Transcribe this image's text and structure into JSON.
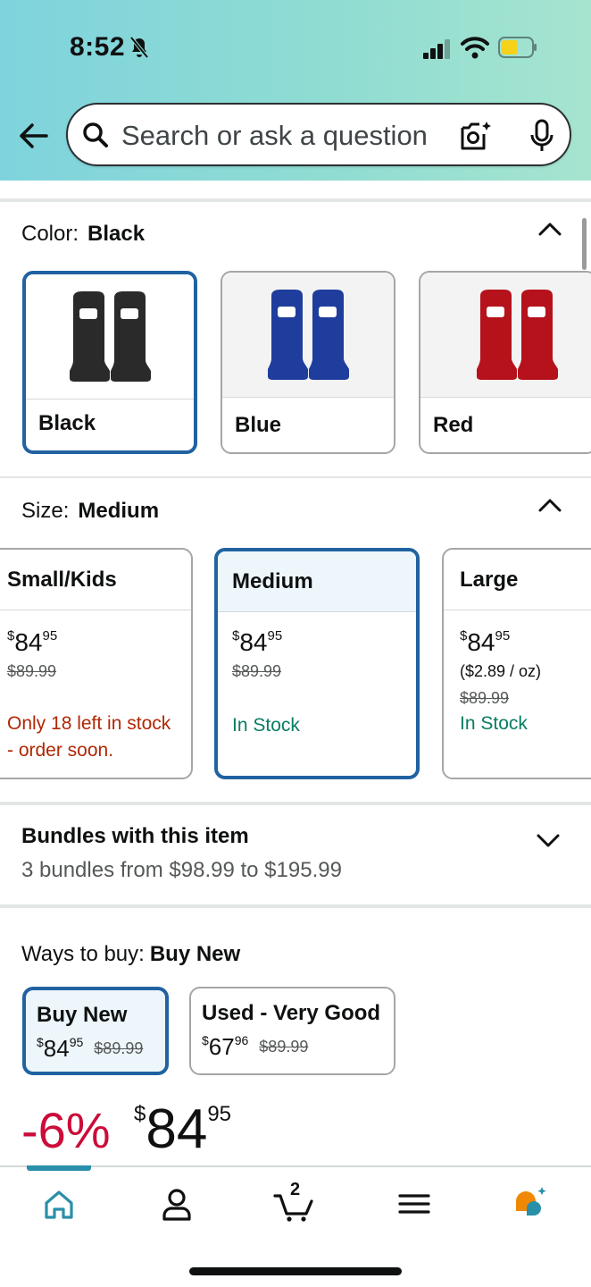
{
  "status_bar": {
    "time": "8:52"
  },
  "search": {
    "placeholder": "Search or ask a question"
  },
  "color_section": {
    "label": "Color:",
    "selected": "Black",
    "options": [
      {
        "label": "Black",
        "tint": "#2a2a2a"
      },
      {
        "label": "Blue",
        "tint": "#1f3d9c"
      },
      {
        "label": "Red",
        "tint": "#b5121b"
      }
    ]
  },
  "size_section": {
    "label": "Size:",
    "selected": "Medium",
    "options": [
      {
        "label": "Small/Kids",
        "price_whole": "84",
        "price_cents": "95",
        "currency": "$",
        "list_price": "$89.99",
        "unit_price": "",
        "stock": "Only 18 left in stock - order soon."
      },
      {
        "label": "Medium",
        "price_whole": "84",
        "price_cents": "95",
        "currency": "$",
        "list_price": "$89.99",
        "unit_price": "",
        "stock": "In Stock"
      },
      {
        "label": "Large",
        "price_whole": "84",
        "price_cents": "95",
        "currency": "$",
        "list_price": "$89.99",
        "unit_price": "($2.89 / oz)",
        "stock": "In Stock"
      }
    ]
  },
  "bundles": {
    "title": "Bundles with this item",
    "subtitle": "3 bundles from $98.99 to $195.99"
  },
  "ways_to_buy": {
    "label": "Ways to buy:",
    "selected": "Buy New",
    "options": [
      {
        "title": "Buy New",
        "currency": "$",
        "price_whole": "84",
        "price_cents": "95",
        "list_price": "$89.99"
      },
      {
        "title": "Used - Very Good",
        "currency": "$",
        "price_whole": "67",
        "price_cents": "96",
        "list_price": "$89.99"
      }
    ]
  },
  "price_block": {
    "discount": "-6%",
    "currency": "$",
    "price_whole": "84",
    "price_cents": "95"
  },
  "bottom_nav": {
    "cart_count": "2",
    "items": [
      "home-icon",
      "account-icon",
      "cart-icon",
      "menu-icon",
      "rufus-icon"
    ]
  },
  "colors": {
    "accent": "#2162a1",
    "deal_red": "#cc0c39",
    "in_stock_green": "#067d62",
    "low_stock_red": "#b12704"
  }
}
